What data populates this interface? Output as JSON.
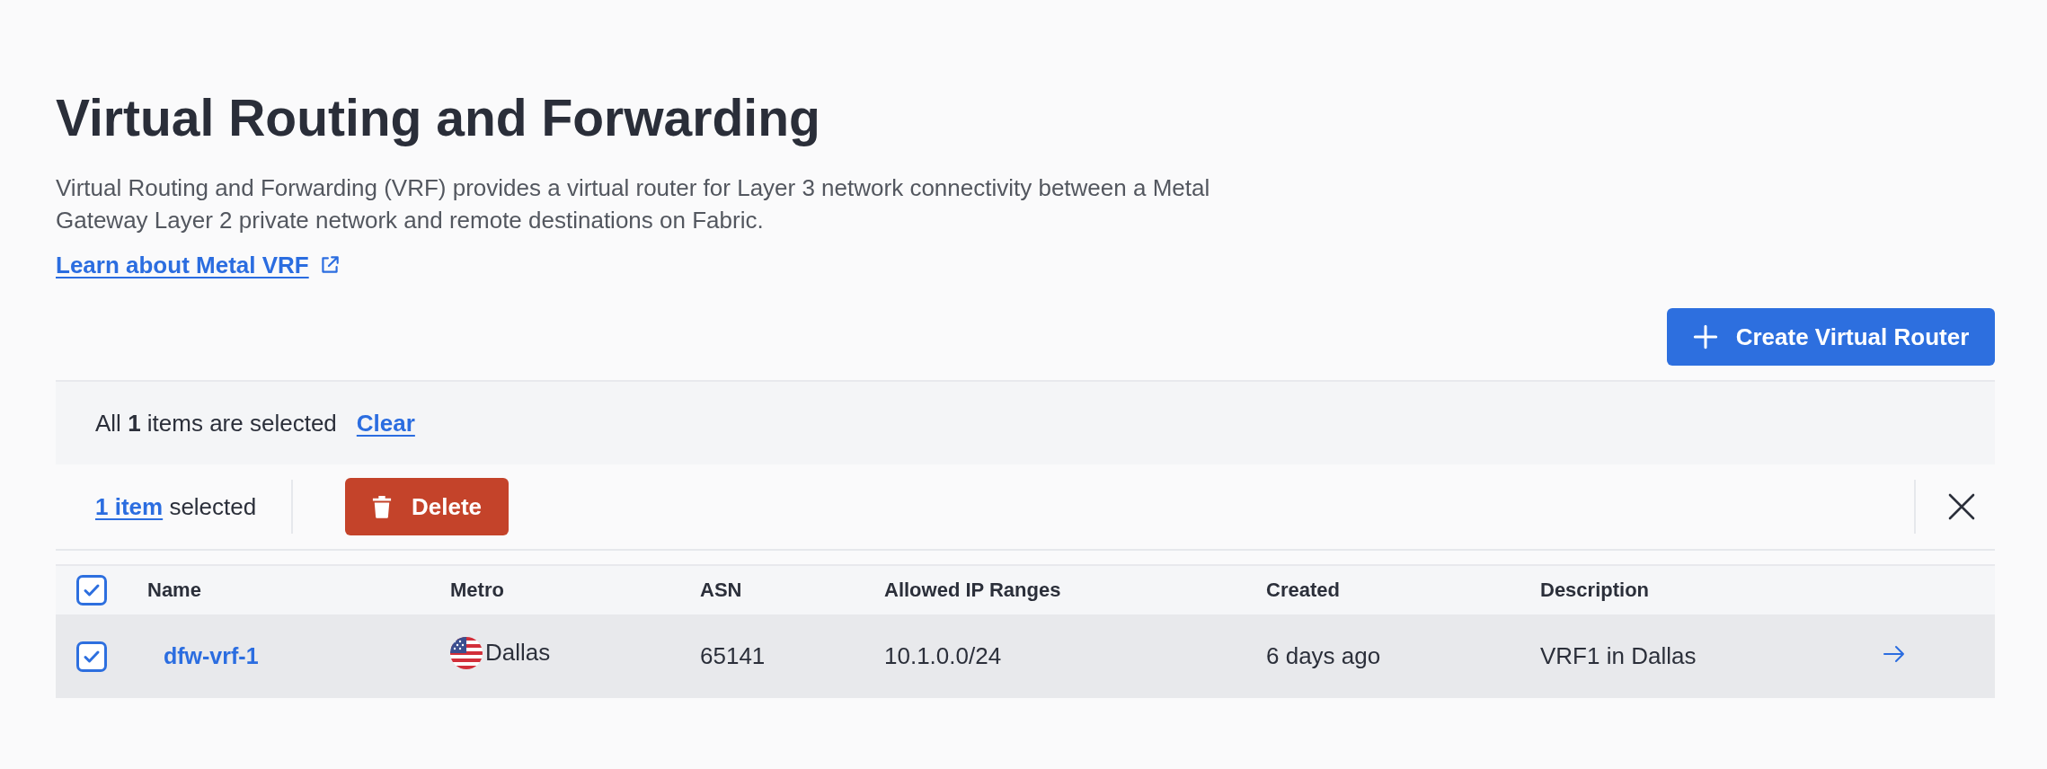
{
  "page": {
    "title": "Virtual Routing and Forwarding",
    "description": "Virtual Routing and Forwarding (VRF) provides a virtual router for Layer 3 network connectivity between a Metal Gateway Layer 2 private network and remote destinations on Fabric.",
    "learn_link": "Learn about Metal VRF"
  },
  "create_button": "Create Virtual Router",
  "selection_banner": {
    "text": "All **1** items are selected",
    "clear_link": "Clear"
  },
  "bulk_actions": {
    "count_link": "1 item",
    "count_suffix": "selected",
    "delete_button": "Delete"
  },
  "table": {
    "all_selected": true,
    "columns": [
      "Name",
      "Metro",
      "ASN",
      "Allowed IP Ranges",
      "Created",
      "Description"
    ],
    "rows": [
      {
        "selected": true,
        "name": "dfw-vrf-1",
        "metro": "Dallas",
        "asn": "65141",
        "ip_ranges": "10.1.0.0/24",
        "created": "6 days ago",
        "description": "VRF1 in Dallas"
      }
    ]
  }
}
